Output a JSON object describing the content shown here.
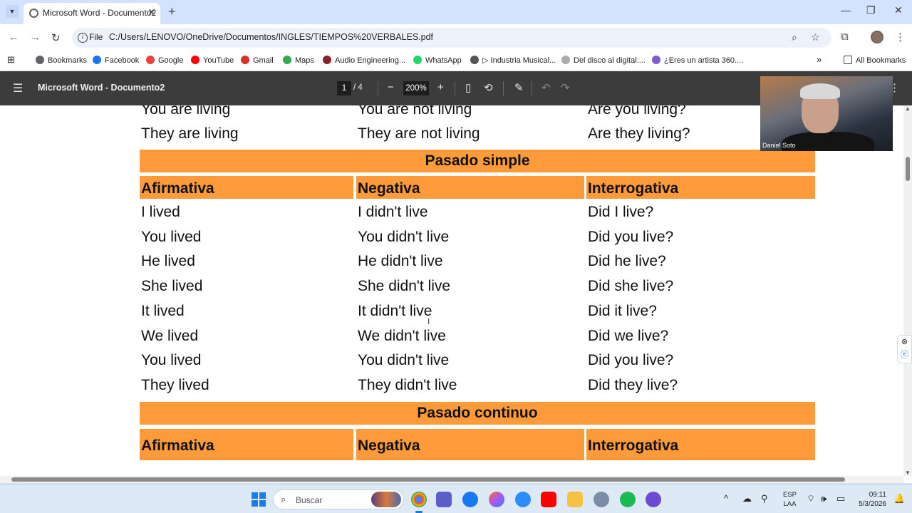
{
  "browser": {
    "tab_title": "Microsoft Word - Documento2",
    "tab_close": "✕",
    "new_tab": "+",
    "address_scheme_label": "File",
    "address_url": "C:/Users/LENOVO/OneDrive/Documentos/INGLES/TIEMPOS%20VERBALES.pdf",
    "bookmarks": [
      {
        "label": "Bookmarks",
        "icon": "star-icon",
        "color": "#5f6368"
      },
      {
        "label": "Facebook",
        "icon": "facebook-icon",
        "color": "#1877f2"
      },
      {
        "label": "Google",
        "icon": "google-icon",
        "color": "#ea4335"
      },
      {
        "label": "YouTube",
        "icon": "youtube-icon",
        "color": "#ff0000"
      },
      {
        "label": "Gmail",
        "icon": "gmail-icon",
        "color": "#d93025"
      },
      {
        "label": "Maps",
        "icon": "maps-icon",
        "color": "#34a853"
      },
      {
        "label": "Audio Engineering...",
        "icon": "audio-engineering-icon",
        "color": "#8b1e2b"
      },
      {
        "label": "WhatsApp",
        "icon": "whatsapp-icon",
        "color": "#25d366"
      },
      {
        "label": "▷ Industria Musical...",
        "icon": "industria-icon",
        "color": "#555555"
      },
      {
        "label": "Del disco al digital:...",
        "icon": "disco-icon",
        "color": "#aaaaaa"
      },
      {
        "label": "¿Eres un artista 360....",
        "icon": "artista-icon",
        "color": "#7b5cd6"
      }
    ],
    "all_bookmarks": "All Bookmarks"
  },
  "pdf_viewer": {
    "title": "Microsoft Word - Documento2",
    "page_current": "1",
    "page_total": "/ 4",
    "zoom": "200%"
  },
  "document": {
    "present_continuous_tail": [
      [
        "You are living",
        "You are not living",
        "Are you living?"
      ],
      [
        "They are living",
        "They are not living",
        "Are they living?"
      ]
    ],
    "past_simple": {
      "title": "Pasado simple",
      "headers": [
        "Afirmativa",
        "Negativa",
        "Interrogativa"
      ],
      "rows": [
        [
          "I lived",
          "I didn't live",
          "Did I live?"
        ],
        [
          "You lived",
          "You didn't live",
          "Did you live?"
        ],
        [
          "He lived",
          "He didn't live",
          "Did he live?"
        ],
        [
          "She lived",
          "She didn't live",
          "Did she live?"
        ],
        [
          "It lived",
          "It didn't live",
          "Did it live?"
        ],
        [
          "We lived",
          "We didn't live",
          "Did we live?"
        ],
        [
          "You lived",
          "You didn't live",
          "Did you live?"
        ],
        [
          "They lived",
          "They didn't live",
          "Did they live?"
        ]
      ]
    },
    "past_continuous": {
      "title": "Pasado continuo",
      "headers": [
        "Afirmativa",
        "Negativa",
        "Interrogativa"
      ]
    }
  },
  "video_call": {
    "participant_name": "Daniel Soto"
  },
  "taskbar": {
    "search_placeholder": "Buscar",
    "language_line1": "ESP",
    "language_line2": "LAA",
    "time": "09:11",
    "date": "5/3/2026"
  },
  "colors": {
    "accent_orange": "#fd9a3a",
    "pdf_toolbar": "#3c3c3c",
    "tab_strip": "#d3e3fd"
  }
}
